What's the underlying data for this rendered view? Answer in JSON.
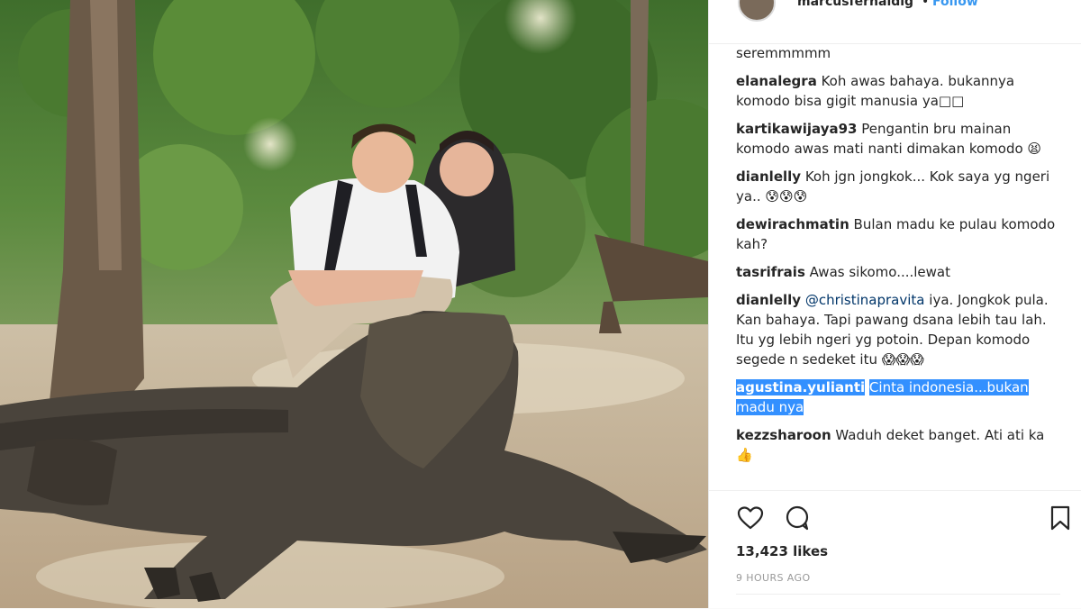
{
  "post": {
    "username": "marcusfernaldig",
    "separator": "•",
    "follow_label": "Follow",
    "likes": "13,423 likes",
    "time_ago": "9 HOURS AGO"
  },
  "comments": [
    {
      "user": "",
      "text": "seremmmmm"
    },
    {
      "user": "elanalegra",
      "text": "Koh awas bahaya. bukannya komodo bisa gigit manusia ya□□"
    },
    {
      "user": "kartikawijaya93",
      "text": "Pengantin bru mainan komodo awas mati nanti dimakan komodo 😫"
    },
    {
      "user": "dianlelly",
      "text": "Koh jgn jongkok... Kok saya yg ngeri ya.. 😰😰😰"
    },
    {
      "user": "dewirachmatin",
      "text": "Bulan madu ke pulau komodo kah?"
    },
    {
      "user": "tasrifrais",
      "text": "Awas sikomo....lewat"
    },
    {
      "user": "dianlelly",
      "mention": "@christinapravita",
      "text": "iya. Jongkok pula. Kan bahaya. Tapi pawang dsana lebih tau lah. Itu yg lebih ngeri yg potoin. Depan komodo segede n sedeket itu 😱😱😱"
    },
    {
      "user": "agustina.yulianti",
      "text": "Cinta indonesia...bukan madu nya",
      "highlighted": true
    },
    {
      "user": "kezzsharoon",
      "text": "Waduh deket banget. Ati ati ka 👍"
    }
  ],
  "icons": {
    "like": "heart-icon",
    "comment": "comment-icon",
    "save": "bookmark-icon"
  },
  "colors": {
    "link_blue": "#3897f0",
    "selection": "#3390ff",
    "text": "#262626",
    "muted": "#999999"
  }
}
